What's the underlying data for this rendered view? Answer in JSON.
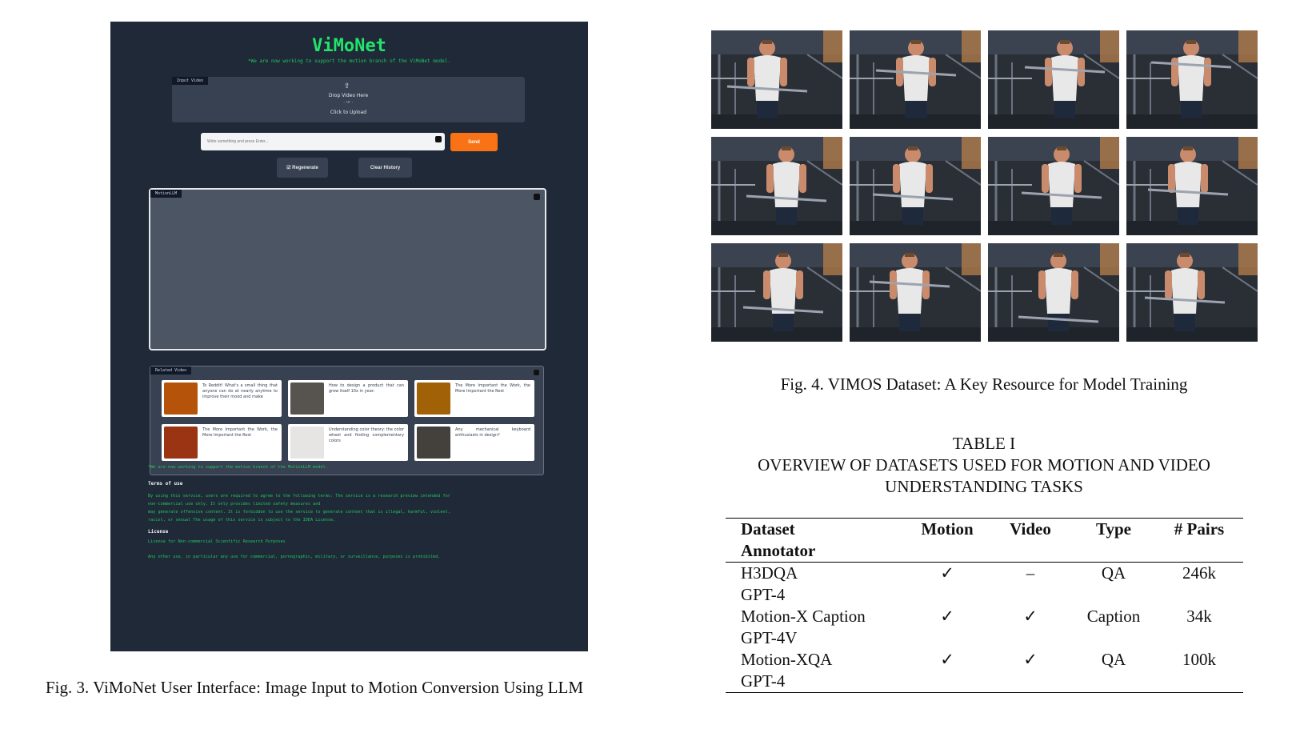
{
  "ui": {
    "title": "ViMoNet",
    "notice_top": "*We are now working to support the motion branch of the ViMoNet model.",
    "input_video_tag": "Input Video",
    "upload_drop": "Drop Video Here",
    "upload_or": "- or -",
    "upload_click": "Click to Upload",
    "chat_placeholder": "Write something and press Enter...",
    "send": "Send",
    "regenerate": "☑ Regenerate",
    "clear_history": "Clear History",
    "chatbox_tag": "MotionLLM",
    "related_tag": "Related Video",
    "related_videos": [
      {
        "text": "To Reddit! What's a small thing that anyone can do at nearly anytime to improve their mood and make",
        "color": "#b45309"
      },
      {
        "text": "How to design a product that can grow itself 10x in year:",
        "color": "#57534e"
      },
      {
        "text": "The More Important the Work, the More Important the Rest",
        "color": "#a16207"
      },
      {
        "text": "The More Important the Work, the More Important the Rest",
        "color": "#9a3412"
      },
      {
        "text": "Understanding color theory: the color wheel and finding complementary colors",
        "color": "#e7e5e4"
      },
      {
        "text": "Any mechanical keyboard enthusiasts in design?",
        "color": "#44403c"
      }
    ],
    "notice_bottom": "*We are now working to support the motion branch of the MotionLLM model.",
    "terms_title": "Terms of use",
    "terms_lines": [
      "By using this service, users are required to agree to the following terms: The service is a research preview intended for",
      "non-commercial use only. It only provides limited safety measures and",
      "may generate offensive content. It is forbidden to use the service to generate content that is illegal, harmful, violent,",
      "racist, or sexual The usage of this service is subject to the IDEA License."
    ],
    "license_title": "License",
    "license_text": "License for Non-commercial Scientific Research Purposes",
    "other_use": "Any other use, in particular any use for commercial, pornographic, military, or surveillance, purposes is prohibited."
  },
  "fig3_caption": "Fig. 3.  ViMoNet User Interface: Image Input to Motion Conversion Using LLM",
  "fig4_caption": "Fig. 4.  VIMOS Dataset: A Key Resource for Model Training",
  "table": {
    "label": "TABLE I",
    "title_line1": "OVERVIEW OF DATASETS USED FOR MOTION AND VIDEO",
    "title_line2": "UNDERSTANDING TASKS",
    "headers": [
      "Dataset",
      "Motion",
      "Video",
      "Type",
      "# Pairs"
    ],
    "header_sub": "Annotator",
    "rows": [
      {
        "dataset": "H3DQA",
        "annotator": "GPT-4",
        "motion": "✓",
        "video": "–",
        "type": "QA",
        "pairs": "246k"
      },
      {
        "dataset": "Motion-X Caption",
        "annotator": "GPT-4V",
        "motion": "✓",
        "video": "✓",
        "type": "Caption",
        "pairs": "34k"
      },
      {
        "dataset": "Motion-XQA",
        "annotator": "GPT-4",
        "motion": "✓",
        "video": "✓",
        "type": "QA",
        "pairs": "100k"
      }
    ]
  },
  "frames": {
    "count": 12,
    "columns": 4,
    "bg_color": "#2a2f36",
    "skin_color": "#c98b6b",
    "shirt_color": "#e8e8e8",
    "bar_color": "#9ca3af"
  }
}
